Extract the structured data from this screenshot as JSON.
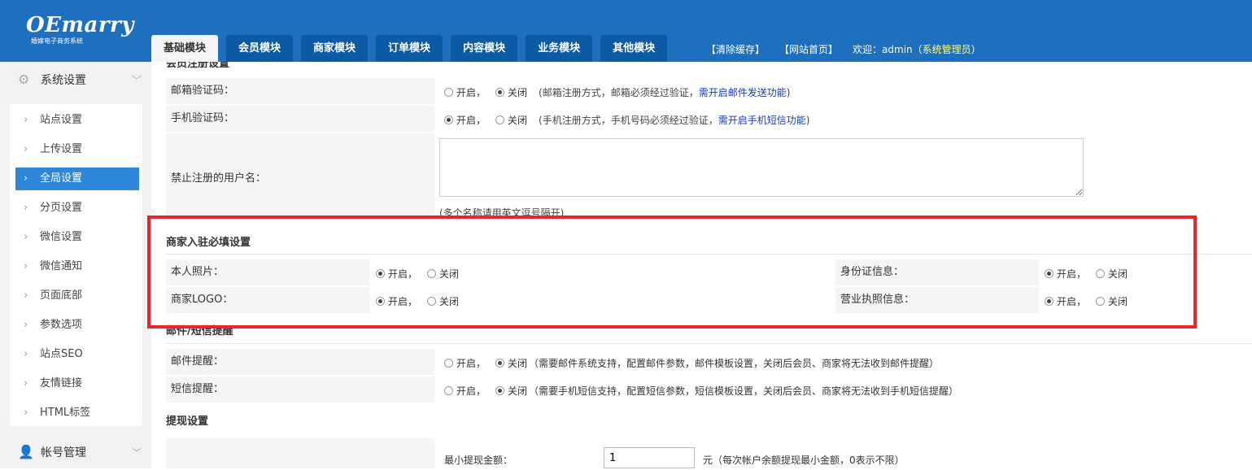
{
  "app": {
    "logo_text": "OEmarry",
    "logo_sub": "婚嫁电子商务系统"
  },
  "tabs": [
    {
      "label": "基础模块",
      "active": true
    },
    {
      "label": "会员模块"
    },
    {
      "label": "商家模块"
    },
    {
      "label": "订单模块"
    },
    {
      "label": "内容模块"
    },
    {
      "label": "业务模块"
    },
    {
      "label": "其他模块"
    }
  ],
  "toplinks": {
    "clear_cache": "【清除缓存】",
    "site_home": "【网站首页】",
    "welcome": "欢迎：admin（",
    "role": "系统管理员",
    "close_paren": "）"
  },
  "sidebar": {
    "group1": "系统设置",
    "items": [
      "站点设置",
      "上传设置",
      "全局设置",
      "分页设置",
      "微信设置",
      "微信通知",
      "页面底部",
      "参数选项",
      "站点SEO",
      "友情链接",
      "HTML标签"
    ],
    "active_index": 2,
    "group2": "帐号管理"
  },
  "form": {
    "clipped_heading": "会员注册设置",
    "email_verify": {
      "label": "邮箱验证码：",
      "on": "开启，",
      "off": "关闭",
      "selected": "off",
      "note": "(邮箱注册方式，邮箱必须经过验证，",
      "note_link": "需开启邮件发送功能",
      "note_end": ")"
    },
    "mobile_verify": {
      "label": "手机验证码：",
      "on": "开启，",
      "off": "关闭",
      "selected": "on",
      "note": "(手机注册方式，手机号码必须经过验证，",
      "note_link": "需开启手机短信功能",
      "note_end": ")"
    },
    "forbidden_names": {
      "label": "禁止注册的用户名：",
      "value": "",
      "hint": "(多个名称请用英文逗号隔开)"
    },
    "merchant_section": {
      "title": "商家入驻必填设置",
      "photo": {
        "label": "本人照片：",
        "on": "开启，",
        "off": "关闭",
        "selected": "on"
      },
      "idcard": {
        "label": "身份证信息：",
        "on": "开启，",
        "off": "关闭",
        "selected": "on"
      },
      "logo": {
        "label": "商家LOGO：",
        "on": "开启，",
        "off": "关闭",
        "selected": "on"
      },
      "license": {
        "label": "营业执照信息：",
        "on": "开启，",
        "off": "关闭",
        "selected": "on"
      }
    },
    "notify_section": {
      "title": "邮件/短信提醒",
      "email": {
        "label": "邮件提醒：",
        "on": "开启，",
        "off": "关闭",
        "selected": "off",
        "note": "（需要邮件系统支持，配置邮件参数，邮件模板设置，关闭后会员、商家将无法收到邮件提醒）"
      },
      "sms": {
        "label": "短信提醒：",
        "on": "开启，",
        "off": "关闭",
        "selected": "off",
        "note": "（需要手机短信支持，配置短信参数，短信模板设置，关闭后会员、商家将无法收到手机短信提醒）"
      }
    },
    "withdraw_section": {
      "title": "提现设置",
      "min_label": "最小提现金额：",
      "min_value": "1",
      "unit_note": "元（每次帐户余额提现最小金额，0表示不限）"
    }
  },
  "colors": {
    "topbar": "#1e6fbd",
    "active_tab": "#f5f5f5",
    "sidebar_active": "#2d86d8",
    "highlight_box": "#e8262c",
    "link": "#1a3ea8",
    "role_text": "#ffff66"
  }
}
